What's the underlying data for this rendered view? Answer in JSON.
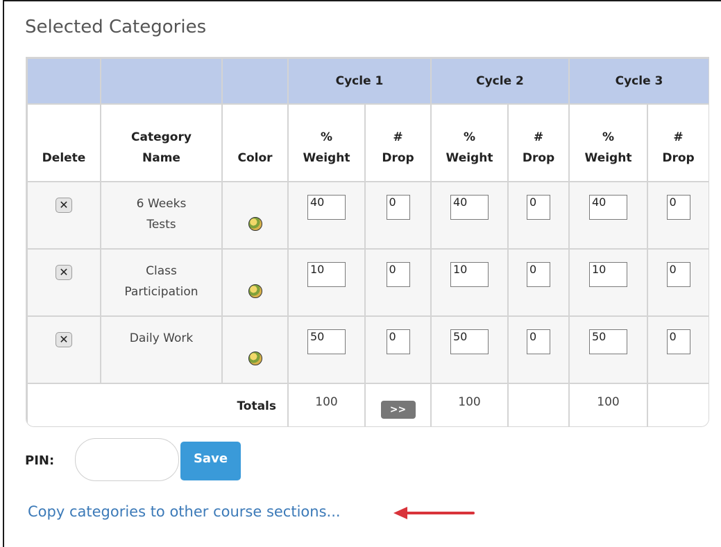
{
  "section_title": "Selected Categories",
  "header": {
    "cycles": [
      "Cycle 1",
      "Cycle 2",
      "Cycle 3"
    ],
    "delete_label": "Delete",
    "category_name_label": "Category Name",
    "color_label": "Color",
    "weight_label": "% Weight",
    "drop_label": "# Drop"
  },
  "rows": [
    {
      "name": "6 Weeks Tests",
      "cycles": [
        {
          "weight": "40",
          "drop": "0"
        },
        {
          "weight": "40",
          "drop": "0"
        },
        {
          "weight": "40",
          "drop": "0"
        }
      ]
    },
    {
      "name": "Class Participation",
      "cycles": [
        {
          "weight": "10",
          "drop": "0"
        },
        {
          "weight": "10",
          "drop": "0"
        },
        {
          "weight": "10",
          "drop": "0"
        }
      ]
    },
    {
      "name": "Daily Work",
      "cycles": [
        {
          "weight": "50",
          "drop": "0"
        },
        {
          "weight": "50",
          "drop": "0"
        },
        {
          "weight": "50",
          "drop": "0"
        }
      ]
    }
  ],
  "totals": {
    "label": "Totals",
    "values": [
      "100",
      "100",
      "100"
    ],
    "copy_button": ">>"
  },
  "pin": {
    "label": "PIN:",
    "value": ""
  },
  "save_label": "Save",
  "copy_link": "Copy categories to other course sections...",
  "icons": {
    "delete": "close-icon",
    "color": "palette-icon"
  },
  "colors": {
    "header_bg": "#bccbea",
    "save_bg": "#3a9ad9",
    "link": "#3c7ab8",
    "arrow": "#d9333a"
  }
}
